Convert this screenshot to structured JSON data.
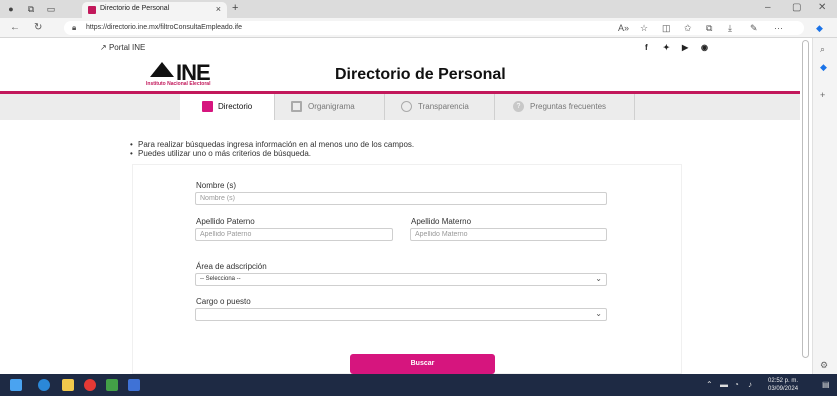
{
  "browser": {
    "tab_title": "Directorio de Personal",
    "tab_close": "×",
    "new_tab": "+",
    "url": "https://directorio.ine.mx/filtroConsultaEmpleado.ife",
    "window_min": "–",
    "window_restore": "▢",
    "window_close": "✕"
  },
  "site": {
    "portal_link": "Portal INE",
    "logo_text": "INE",
    "logo_subtext": "Instituto Nacional Electoral",
    "page_title": "Directorio de Personal",
    "brand_color": "#c2185b",
    "button_color": "#d6157e"
  },
  "nav": {
    "tabs": [
      {
        "label": "Directorio",
        "icon": "directory-icon",
        "active": true
      },
      {
        "label": "Organigrama",
        "icon": "org-chart-icon",
        "active": false
      },
      {
        "label": "Transparencia",
        "icon": "magnifier-icon",
        "active": false
      },
      {
        "label": "Preguntas frecuentes",
        "icon": "question-icon",
        "active": false
      }
    ]
  },
  "instructions": [
    "Para realizar búsquedas ingresa información en al menos uno de los campos.",
    "Puedes utilizar uno o más criterios de búsqueda."
  ],
  "form": {
    "nombre_label": "Nombre (s)",
    "nombre_placeholder": "Nombre (s)",
    "paterno_label": "Apellido Paterno",
    "paterno_placeholder": "Apellido Paterno",
    "materno_label": "Apellido Materno",
    "materno_placeholder": "Apellido Materno",
    "area_label": "Área de adscripción",
    "area_value": "-- Selecciona --",
    "cargo_label": "Cargo o puesto",
    "cargo_value": "",
    "submit_label": "Buscar"
  },
  "taskbar": {
    "time": "02:52 p. m.",
    "date": "03/09/2024"
  }
}
